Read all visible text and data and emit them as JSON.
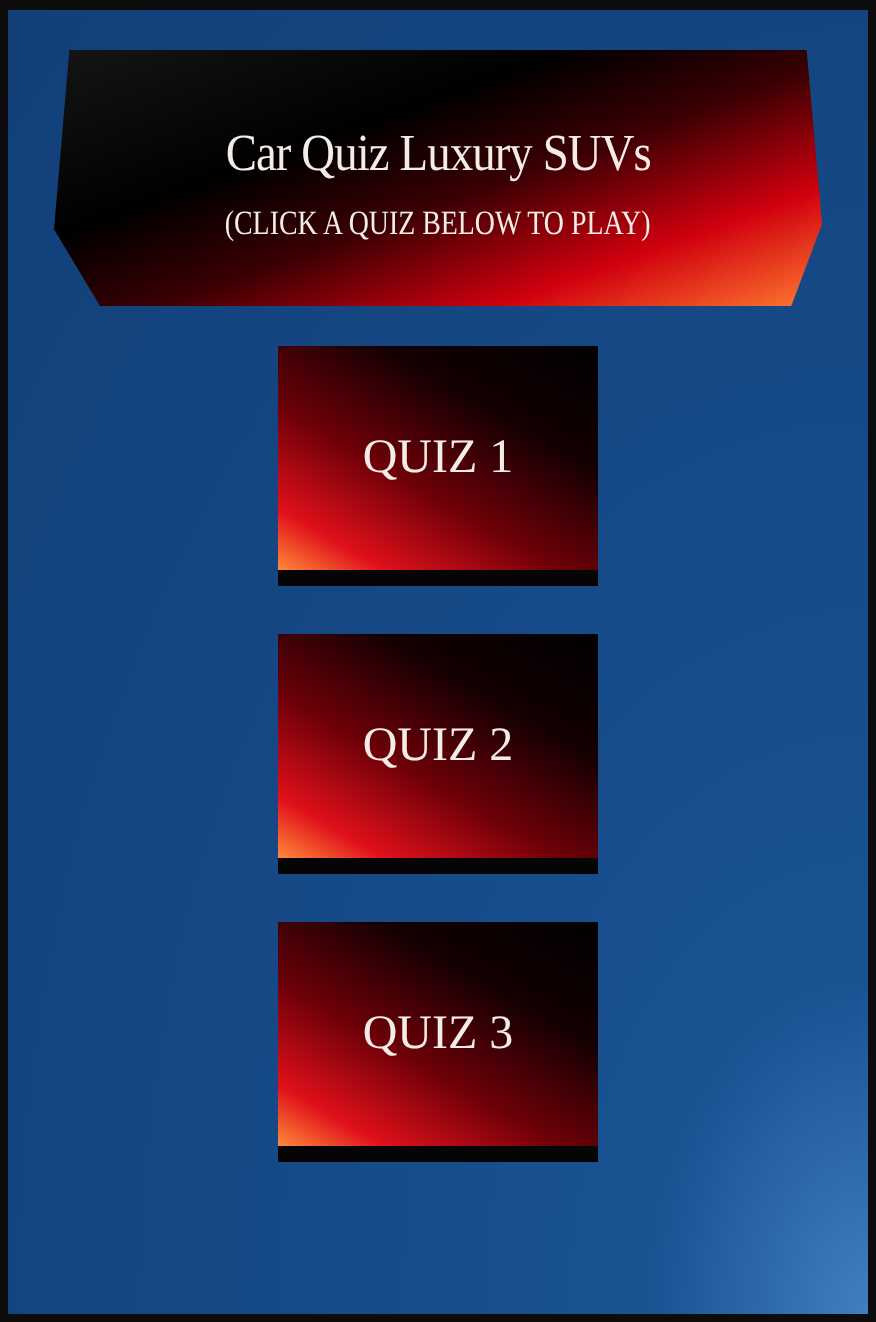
{
  "header": {
    "title": "Car Quiz Luxury SUVs",
    "subtitle": "(CLICK A QUIZ BELOW TO PLAY)"
  },
  "quizzes": [
    {
      "label": "QUIZ 1"
    },
    {
      "label": "QUIZ 2"
    },
    {
      "label": "QUIZ 3"
    }
  ]
}
